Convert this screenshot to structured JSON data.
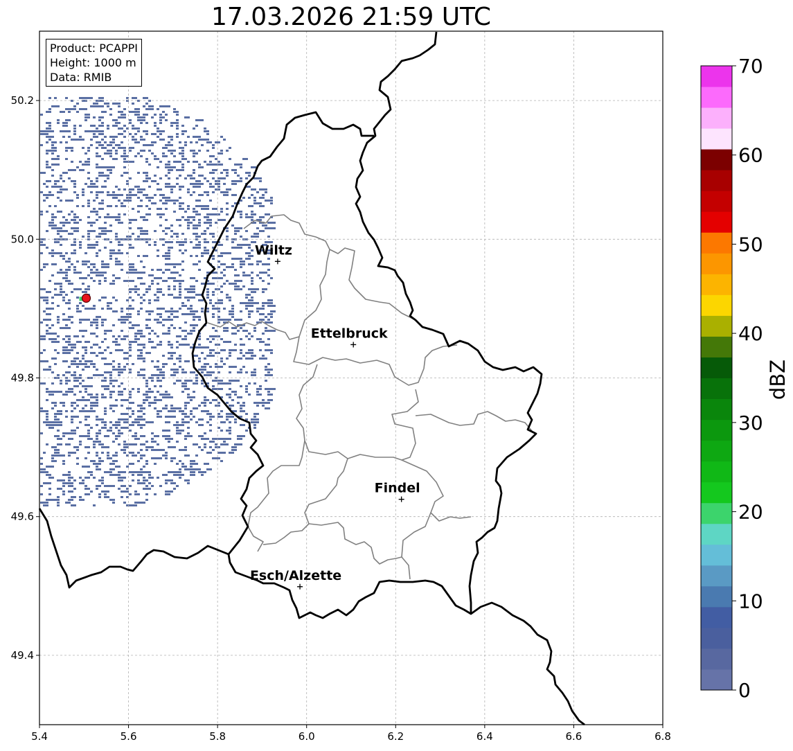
{
  "title": "17.03.2026 21:59 UTC",
  "info": {
    "product": "Product: PCAPPI",
    "height": "Height: 1000 m",
    "data": "Data: RMIB"
  },
  "map": {
    "lon_range": [
      5.4,
      6.8
    ],
    "lat_range": [
      49.3,
      50.3
    ],
    "x_ticks": [
      "5.4",
      "5.6",
      "5.8",
      "6.0",
      "6.2",
      "6.4",
      "6.6",
      "6.8"
    ],
    "y_ticks": [
      "49.4",
      "49.6",
      "49.8",
      "50.0",
      "50.2"
    ],
    "x_tick_values": [
      5.4,
      5.6,
      5.8,
      6.0,
      6.2,
      6.4,
      6.6,
      6.8
    ],
    "y_tick_values": [
      49.4,
      49.6,
      49.8,
      50.0,
      50.2
    ],
    "grid": true,
    "cities": [
      {
        "name": "Wiltz",
        "lon": 5.935,
        "lat": 49.968
      },
      {
        "name": "Ettelbruck",
        "lon": 6.105,
        "lat": 49.848
      },
      {
        "name": "Findel",
        "lon": 6.213,
        "lat": 49.625
      },
      {
        "name": "Esch/Alzette",
        "lon": 5.985,
        "lat": 49.499
      }
    ],
    "radar_site": {
      "lon": 5.505,
      "lat": 49.915,
      "color": "#e8141c"
    },
    "colors": {
      "border_country": "#000000",
      "border_canton": "#808080",
      "grid": "#b0b0b0",
      "echo": "#5a6fa3"
    }
  },
  "colorbar": {
    "label": "dBZ",
    "min": 0,
    "max": 70,
    "ticks": [
      "0",
      "10",
      "20",
      "30",
      "40",
      "50",
      "60",
      "70"
    ],
    "tick_values": [
      0,
      10,
      20,
      30,
      40,
      50,
      60,
      70
    ],
    "colors": [
      "#6673a8",
      "#5868a0",
      "#4a5f9e",
      "#425da3",
      "#4a7ab0",
      "#5a9ac4",
      "#64bed8",
      "#5ed6c4",
      "#3cd46c",
      "#14c81e",
      "#10b816",
      "#0ea812",
      "#0c980e",
      "#0a860c",
      "#08720a",
      "#065a08",
      "#447808",
      "#aab000",
      "#fcd600",
      "#fcb400",
      "#fc9600",
      "#fc7800",
      "#e40000",
      "#c40000",
      "#a80000",
      "#7c0000",
      "#fde4fe",
      "#fcb0fc",
      "#fc6afc",
      "#ec34ec"
    ]
  }
}
